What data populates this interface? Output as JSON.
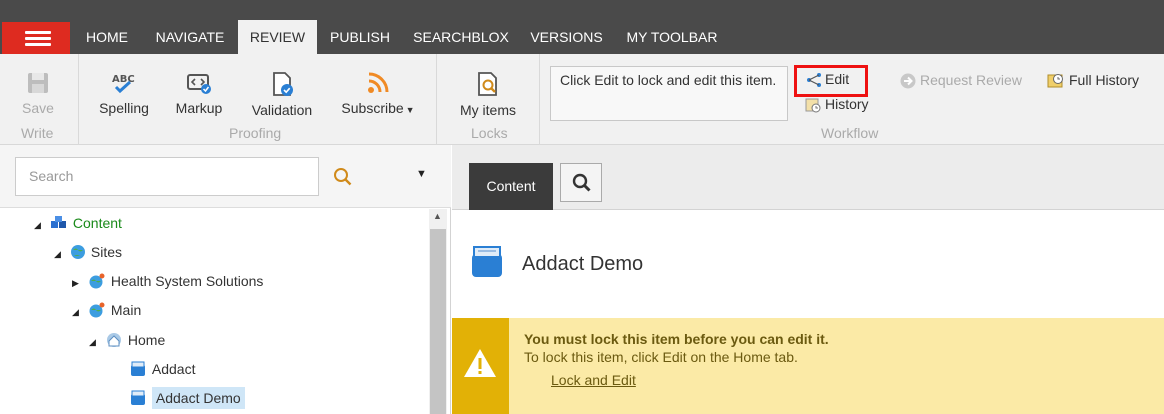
{
  "nav": {
    "tabs": [
      "HOME",
      "NAVIGATE",
      "REVIEW",
      "PUBLISH",
      "SEARCHBLOX",
      "VERSIONS",
      "MY TOOLBAR"
    ],
    "active_tab": "REVIEW"
  },
  "ribbon": {
    "write": {
      "save": "Save",
      "group": "Write"
    },
    "proofing": {
      "spelling": "Spelling",
      "markup": "Markup",
      "validation": "Validation",
      "subscribe": "Subscribe",
      "group": "Proofing"
    },
    "locks": {
      "my_items": "My items",
      "group": "Locks"
    },
    "workflow": {
      "message": "Click Edit to lock and edit this item.",
      "edit": "Edit",
      "history": "History",
      "request_review": "Request Review",
      "full_history": "Full History",
      "group": "Workflow"
    }
  },
  "search": {
    "placeholder": "Search"
  },
  "tree": {
    "content": "Content",
    "sites": "Sites",
    "health": "Health System Solutions",
    "main": "Main",
    "home": "Home",
    "addact": "Addact",
    "addact_demo": "Addact Demo"
  },
  "editor": {
    "tab_content": "Content",
    "item_title": "Addact Demo",
    "warning_title": "You must lock this item before you can edit it.",
    "warning_body": "To lock this item, click Edit on the Home tab.",
    "warning_link": "Lock and Edit"
  },
  "colors": {
    "brand_red": "#de2b20",
    "nav_bg": "#4a4a4a",
    "warning_bg": "#fbeaa6",
    "warning_accent": "#e2b106",
    "tree_green": "#1a8a1a"
  }
}
